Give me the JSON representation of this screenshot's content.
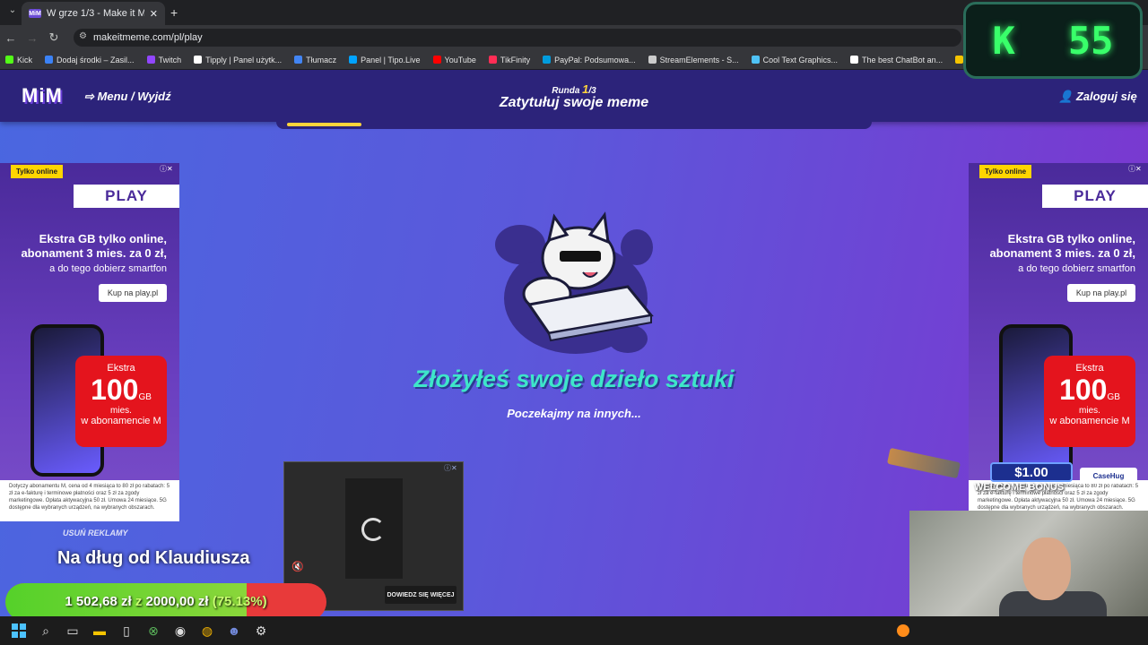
{
  "browser": {
    "tab_title": "W grze 1/3 - Make it Meme",
    "tab_favicon": "MiM",
    "url": "makeitmeme.com/pl/play",
    "bookmarks": [
      {
        "label": "Kick",
        "color": "#53fc18"
      },
      {
        "label": "Dodaj środki – Zasil...",
        "color": "#3b82f6"
      },
      {
        "label": "Twitch",
        "color": "#9146ff"
      },
      {
        "label": "Tipply | Panel użytk...",
        "color": "#ffffff"
      },
      {
        "label": "Tłumacz",
        "color": "#4285f4"
      },
      {
        "label": "Panel | Tipo.Live",
        "color": "#00a3ff"
      },
      {
        "label": "YouTube",
        "color": "#ff0000"
      },
      {
        "label": "TikFinity",
        "color": "#ff2d55"
      },
      {
        "label": "PayPal: Podsumowa...",
        "color": "#009cde"
      },
      {
        "label": "StreamElements - S...",
        "color": "#cccccc"
      },
      {
        "label": "Cool Text Graphics...",
        "color": "#4fc3f7"
      },
      {
        "label": "The best ChatBot an...",
        "color": "#ffffff"
      },
      {
        "label": "Usuń tło z obrazu -...",
        "color": "#f5c400"
      }
    ]
  },
  "site": {
    "logo": "MiM",
    "menu_label": "Menu / Wyjdź",
    "round_label": "Runda",
    "round_current": "1",
    "round_total": "/3",
    "page_title": "Zatytułuj swoje meme",
    "login_label": "Zaloguj się",
    "progress_fraction": 0.13
  },
  "main": {
    "submitted_text": "Złożyłeś swoje dzieło sztuki",
    "waiting_text": "Poczekajmy na innych..."
  },
  "ad": {
    "tag": "Tylko online",
    "brand": "PLAY",
    "headline_1": "Ekstra GB tylko online,",
    "headline_2": "abonament 3 mies. za 0 zł,",
    "subline": "a do tego dobierz smartfon",
    "cta": "Kup na play.pl",
    "badge_top": "Ekstra",
    "badge_number": "100",
    "badge_unit": "GB",
    "badge_unit_sub": "mies.",
    "badge_bottom": "w abonamencie M",
    "fine_print": "Dotyczy abonamentu M, cena od 4 miesiąca to 80 zł po rabatach: 5 zł za e-fakturę i terminowe płatności oraz 5 zł za zgody marketingowe. Opłata aktywacyjna 50 zł. Umowa 24 miesiące. 5G dostępne dla wybranych urządzeń, na wybranych obszarach."
  },
  "video_ad": {
    "more_label": "DOWIEDZ SIĘ WIĘCEJ"
  },
  "remove_ads": "USUŃ REKLAMY",
  "stream": {
    "overlay_title": "Na dług od Klaudiusza",
    "goal_current": "1 502,68 zł",
    "goal_sep": "z",
    "goal_target": "2000,00 zł",
    "goal_percent": "(75.13%)",
    "goal_fraction": 0.7513,
    "counter_letter": "K",
    "counter_value": "55",
    "promo_amount": "$1.00",
    "promo_text": "WELCOME BONUS",
    "promo_brand": "CaseHug"
  }
}
